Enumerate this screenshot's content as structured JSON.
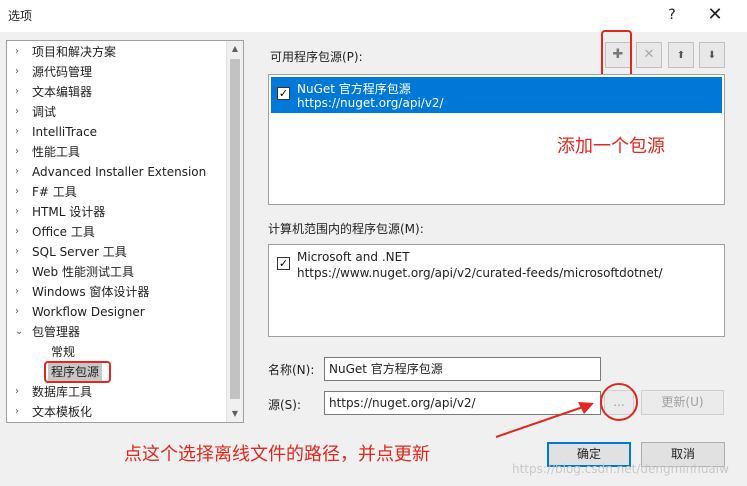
{
  "window": {
    "title": "选项",
    "help": "?",
    "close": "✕"
  },
  "tree": {
    "items": [
      {
        "label": "项目和解决方案",
        "arrow": "›"
      },
      {
        "label": "源代码管理",
        "arrow": "›"
      },
      {
        "label": "文本编辑器",
        "arrow": "›"
      },
      {
        "label": "调试",
        "arrow": "›"
      },
      {
        "label": "IntelliTrace",
        "arrow": "›"
      },
      {
        "label": "性能工具",
        "arrow": "›"
      },
      {
        "label": "Advanced Installer Extension",
        "arrow": "›"
      },
      {
        "label": "F# 工具",
        "arrow": "›"
      },
      {
        "label": "HTML 设计器",
        "arrow": "›"
      },
      {
        "label": "Office 工具",
        "arrow": "›"
      },
      {
        "label": "SQL Server 工具",
        "arrow": "›"
      },
      {
        "label": "Web 性能测试工具",
        "arrow": "›"
      },
      {
        "label": "Windows 窗体设计器",
        "arrow": "›"
      },
      {
        "label": "Workflow Designer",
        "arrow": "›"
      },
      {
        "label": "包管理器",
        "arrow": "⌄"
      },
      {
        "label": "常规",
        "arrow": ""
      },
      {
        "label": "程序包源",
        "arrow": ""
      },
      {
        "label": "数据库工具",
        "arrow": "›"
      },
      {
        "label": "文本模板化",
        "arrow": "›"
      }
    ]
  },
  "available_sources": {
    "label": "可用程序包源(P):",
    "items": [
      {
        "checked": "✓",
        "name": "NuGet 官方程序包源",
        "url": "https://nuget.org/api/v2/"
      }
    ]
  },
  "toolbar": {
    "add": "✚",
    "remove": "✕",
    "up": "⬆",
    "down": "⬇"
  },
  "machine_sources": {
    "label": "计算机范围内的程序包源(M):",
    "items": [
      {
        "checked": "✓",
        "name": "Microsoft and .NET",
        "url": "https://www.nuget.org/api/v2/curated-feeds/microsoftdotnet/"
      }
    ]
  },
  "form": {
    "name_label": "名称(N):",
    "name_value": "NuGet 官方程序包源",
    "source_label": "源(S):",
    "source_value": "https://nuget.org/api/v2/",
    "browse_label": "...",
    "update_label": "更新(U)"
  },
  "buttons": {
    "ok": "确定",
    "cancel": "取消"
  },
  "annotations": {
    "add_source": "添加一个包源",
    "browse_hint": "点这个选择离线文件的路径，并点更新"
  },
  "watermark": "https://blog.csdn.net/dengminhuaiw"
}
